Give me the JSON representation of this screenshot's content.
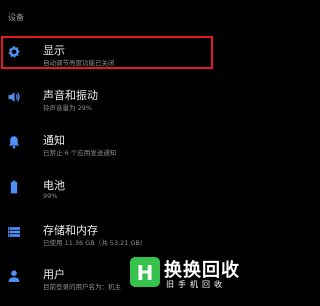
{
  "header": {
    "title": "设备"
  },
  "items": [
    {
      "icon": "settings-gear-icon",
      "title": "显示",
      "subtitle": "自动调节亮度功能已关闭"
    },
    {
      "icon": "volume-icon",
      "title": "声音和振动",
      "subtitle": "铃声音量为 29%"
    },
    {
      "icon": "bell-icon",
      "title": "通知",
      "subtitle": "已禁止 6 个应用发送通知"
    },
    {
      "icon": "battery-icon",
      "title": "电池",
      "subtitle": "99%"
    },
    {
      "icon": "storage-icon",
      "title": "存储和内存",
      "subtitle": "已使用 11.36 GB（共 53.21 GB）"
    },
    {
      "icon": "user-icon",
      "title": "用户",
      "subtitle": "目前登录的用户名为：机主"
    }
  ],
  "watermark": {
    "logo_letter": "H",
    "title": "换换回收",
    "subtitle": "旧手机回收"
  },
  "colors": {
    "background": "#000000",
    "icon": "#4f8ff7",
    "highlight_border": "#e01b24",
    "watermark_green": "#37c24e"
  }
}
